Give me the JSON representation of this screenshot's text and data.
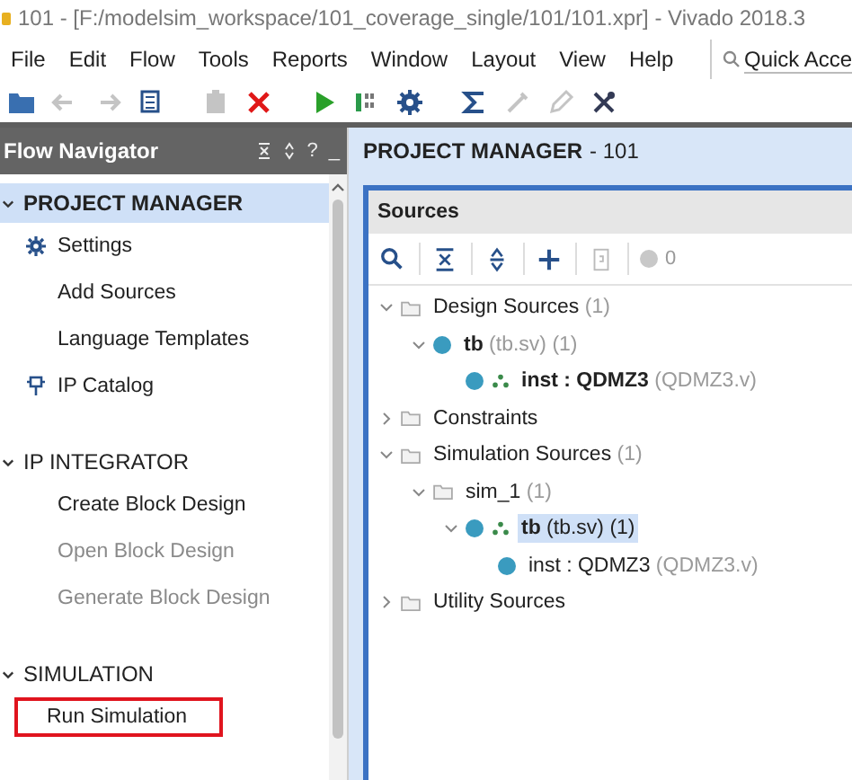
{
  "window": {
    "title": "101 - [F:/modelsim_workspace/101_coverage_single/101/101.xpr] - Vivado 2018.3"
  },
  "menu": [
    "File",
    "Edit",
    "Flow",
    "Tools",
    "Reports",
    "Window",
    "Layout",
    "View",
    "Help"
  ],
  "quick_access": {
    "placeholder": "Quick Acce"
  },
  "toolbar": [
    {
      "kind": "open",
      "disabled": false
    },
    {
      "kind": "undo",
      "disabled": true
    },
    {
      "kind": "redo",
      "disabled": true
    },
    {
      "kind": "copy",
      "disabled": false
    },
    {
      "kind": "paste",
      "disabled": true
    },
    {
      "kind": "delete",
      "disabled": false
    },
    {
      "kind": "run",
      "disabled": false
    },
    {
      "kind": "program",
      "disabled": false
    },
    {
      "kind": "settings",
      "disabled": false
    },
    {
      "kind": "sigma",
      "disabled": false
    },
    {
      "kind": "ruler",
      "disabled": true
    },
    {
      "kind": "pencil",
      "disabled": true
    },
    {
      "kind": "tools",
      "disabled": false
    }
  ],
  "flow_navigator": {
    "title": "Flow Navigator",
    "buttons": [
      "?",
      "_"
    ],
    "sections": [
      {
        "label": "PROJECT MANAGER",
        "expanded": true,
        "selected": true,
        "items": [
          {
            "label": "Settings",
            "kind": "settings",
            "disabled": false,
            "marked": false
          },
          {
            "label": "Add Sources",
            "disabled": false,
            "marked": false
          },
          {
            "label": "Language Templates",
            "disabled": false,
            "marked": false
          },
          {
            "label": "IP Catalog",
            "kind": "catalog",
            "disabled": false,
            "marked": false
          }
        ]
      },
      {
        "label": "IP INTEGRATOR",
        "expanded": true,
        "selected": false,
        "items": [
          {
            "label": "Create Block Design",
            "disabled": false,
            "marked": false
          },
          {
            "label": "Open Block Design",
            "disabled": true,
            "marked": false
          },
          {
            "label": "Generate Block Design",
            "disabled": true,
            "marked": false
          }
        ]
      },
      {
        "label": "SIMULATION",
        "expanded": true,
        "selected": false,
        "items": [
          {
            "label": "Run Simulation",
            "disabled": false,
            "marked": true
          }
        ]
      }
    ]
  },
  "main": {
    "title": "PROJECT MANAGER",
    "subtitle": "- 101",
    "sources": {
      "title": "Sources",
      "message_count": "0",
      "tree": [
        {
          "kind": "folder",
          "label": "Design Sources",
          "detail": "(1)",
          "expanded": true,
          "selected": false,
          "children": [
            {
              "kind": "module",
              "label": "tb",
              "detail": "(tb.sv) (1)",
              "bold": true,
              "expanded": true,
              "selected": false,
              "children": [
                {
                  "kind": "hier_module",
                  "label": "inst : QDMZ3",
                  "detail": "(QDMZ3.v)",
                  "bold": true,
                  "selected": false
                }
              ]
            }
          ]
        },
        {
          "kind": "folder",
          "label": "Constraints",
          "expanded": false,
          "selected": false
        },
        {
          "kind": "folder",
          "label": "Simulation Sources",
          "detail": "(1)",
          "expanded": true,
          "selected": false,
          "children": [
            {
              "kind": "folder",
              "label": "sim_1",
              "detail": "(1)",
              "expanded": true,
              "selected": false,
              "children": [
                {
                  "kind": "hier_module",
                  "label": "tb",
                  "detail": "(tb.sv) (1)",
                  "bold": true,
                  "expanded": true,
                  "selected": true,
                  "children": [
                    {
                      "kind": "module",
                      "label": "inst : QDMZ3",
                      "detail": "(QDMZ3.v)",
                      "bold": false,
                      "selected": false
                    }
                  ]
                }
              ]
            }
          ]
        },
        {
          "kind": "folder",
          "label": "Utility Sources",
          "expanded": false,
          "selected": false
        }
      ]
    }
  }
}
